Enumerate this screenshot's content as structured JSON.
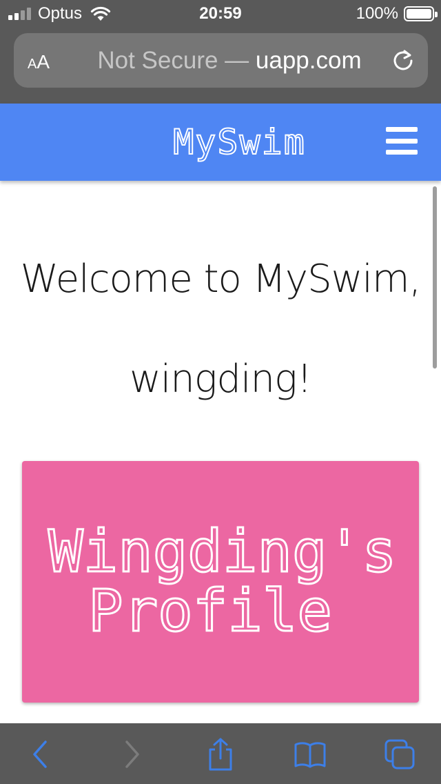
{
  "status_bar": {
    "carrier": "Optus",
    "time": "20:59",
    "battery_percent": "100%",
    "battery_level": 1.0,
    "signal_bars_active": 2,
    "signal_bars_total": 4
  },
  "browser": {
    "text_size_small": "A",
    "text_size_large": "A",
    "url_security_label": "Not Secure — ",
    "url_domain": "uapp.com",
    "accent_color": "#3d7fe8"
  },
  "site": {
    "brand": "MySwim",
    "nav_color": "#4f86f3",
    "welcome_line1": "Welcome to MySwim,",
    "welcome_line2": "wingding!",
    "profile_title_line1": "Wingding's",
    "profile_title_line2": "Profile",
    "card_color": "#ec67a2"
  },
  "icons": {
    "reload": "reload-icon",
    "menu": "hamburger-menu-icon",
    "back": "chevron-left-icon",
    "forward": "chevron-right-icon",
    "share": "share-icon",
    "bookmarks": "book-icon",
    "tabs": "tabs-icon"
  }
}
